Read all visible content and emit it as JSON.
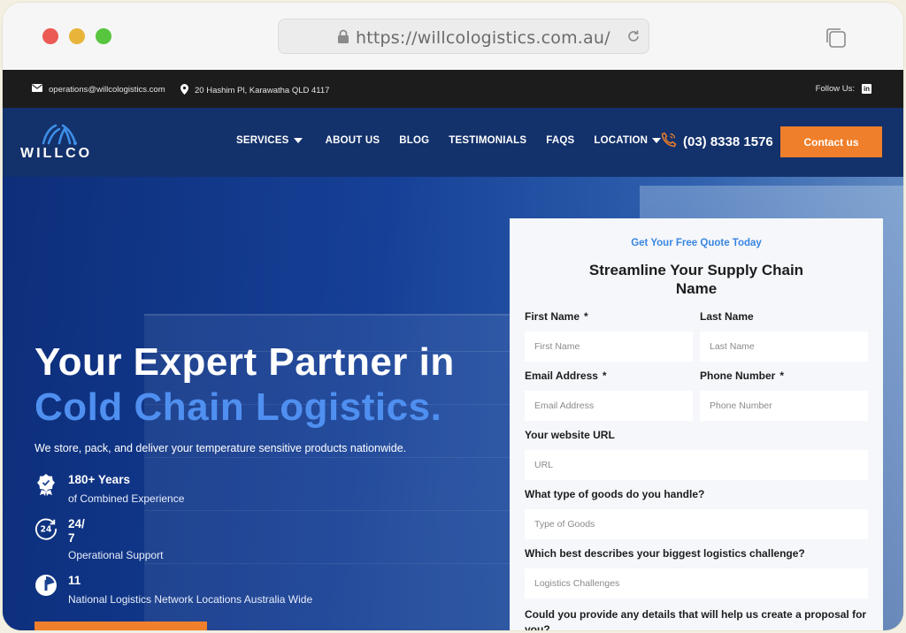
{
  "browser": {
    "url": "https://willcologistics.com.au/"
  },
  "topbar": {
    "email": "operations@willcologistics.com",
    "address": "20 Hashim Pl, Karawatha QLD 4117",
    "follow_label": "Follow Us:",
    "social": "in"
  },
  "nav": {
    "logo_text": "WILLCO",
    "items": [
      {
        "label": "SERVICES",
        "dropdown": true
      },
      {
        "label": "ABOUT US",
        "dropdown": false
      },
      {
        "label": "BLOG",
        "dropdown": false
      },
      {
        "label": "TESTIMONIALS",
        "dropdown": false
      },
      {
        "label": "FAQS",
        "dropdown": false
      },
      {
        "label": "LOCATION",
        "dropdown": true
      }
    ],
    "phone": "(03) 8338 1576",
    "contact_label": "Contact us"
  },
  "hero": {
    "title_line1": "Your Expert Partner in",
    "title_line2": "Cold Chain Logistics.",
    "subtitle": "We store, pack, and deliver your temperature sensitive products nationwide.",
    "stats": [
      {
        "value": "180+ Years",
        "caption": "of Combined Experience"
      },
      {
        "value": "24/\n7",
        "value_a": "24/",
        "value_b": "7",
        "caption": "Operational Support"
      },
      {
        "value": "11",
        "caption": "National Logistics Network Locations Australia Wide"
      }
    ]
  },
  "form": {
    "kicker": "Get Your Free Quote Today",
    "title": "Streamline Your Supply Chain Name",
    "first_name_label": "First Name",
    "first_name_placeholder": "First Name",
    "last_name_label": "Last Name",
    "last_name_placeholder": "Last Name",
    "email_label": "Email Address",
    "email_placeholder": "Email Address",
    "phone_label": "Phone Number",
    "phone_placeholder": "Phone Number",
    "url_label": "Your website URL",
    "url_placeholder": "URL",
    "goods_label": "What type of goods do you handle?",
    "goods_placeholder": "Type of Goods",
    "challenge_label": "Which best describes your biggest logistics challenge?",
    "challenge_placeholder": "Logistics Challenges",
    "details_label": "Could you provide any details that will help us create a proposal for you?",
    "required_mark": "*"
  },
  "colors": {
    "accent": "#ef7f2a",
    "nav_bg": "#13316b",
    "highlight_blue": "#4f8ff0",
    "kicker_blue": "#3a86e0"
  }
}
